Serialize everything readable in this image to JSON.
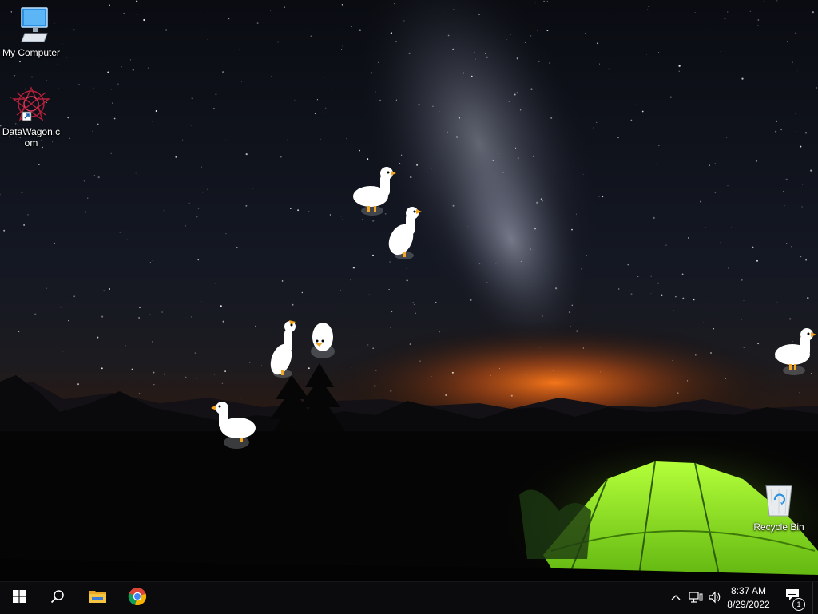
{
  "desktop": {
    "icons": [
      {
        "label": "My Computer",
        "icon": "computer-icon"
      },
      {
        "label": "DataWagon.com",
        "icon": "datawagon-shortcut-icon"
      },
      {
        "label": "Recycle Bin",
        "icon": "recycle-bin-icon"
      }
    ],
    "wallpaper": "night-sky-milky-way-tent"
  },
  "taskbar": {
    "start": {
      "icon": "windows-start-icon"
    },
    "search": {
      "icon": "search-icon"
    },
    "pinned": [
      {
        "icon": "file-explorer-icon"
      },
      {
        "icon": "chrome-icon"
      }
    ],
    "tray": {
      "icons": [
        "chevron-up-icon",
        "network-icon",
        "volume-icon"
      ],
      "time": "8:37 AM",
      "date": "8/29/2022",
      "notification_count": "1"
    }
  },
  "colors": {
    "taskbar": "#0b0b0e",
    "explorer_yellow": "#f4c542",
    "tent_green": "#8be21f",
    "goose_beak": "#f5a623"
  }
}
